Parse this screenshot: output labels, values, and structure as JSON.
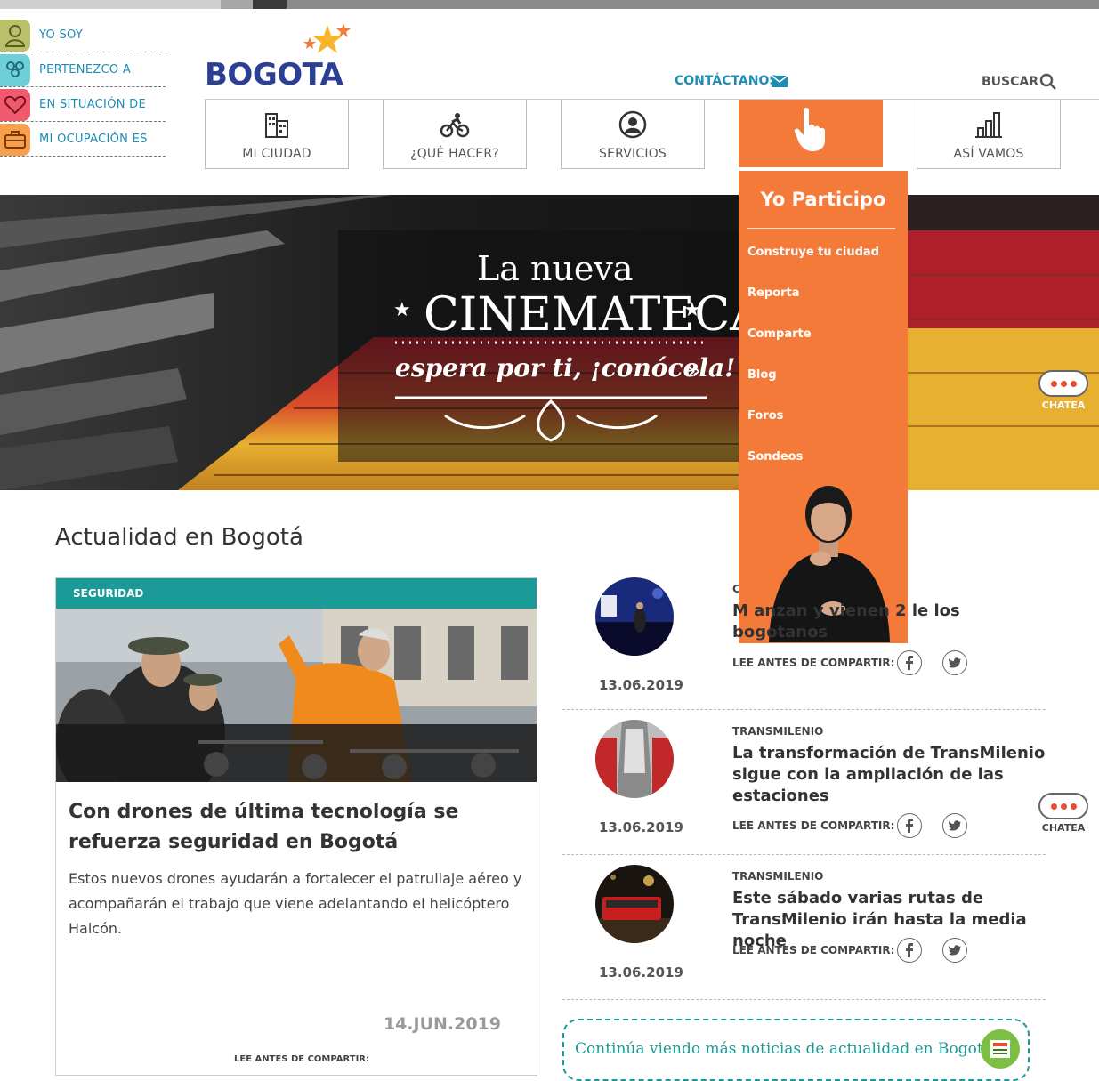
{
  "profiles": [
    {
      "label": "YO SOY",
      "color": "#b9c06a"
    },
    {
      "label": "PERTENEZCO A",
      "color": "#6fcfd8"
    },
    {
      "label": "EN SITUACIÓN DE",
      "color": "#f05a6e"
    },
    {
      "label": "MI OCUPACIÓN ES",
      "color": "#f6a04d"
    }
  ],
  "logo": {
    "word": "BOGOTA"
  },
  "header": {
    "contact": "CONTÁCTANOS",
    "search": "BUSCAR"
  },
  "nav": [
    {
      "label": "MI CIUDAD",
      "icon": "buildings-icon"
    },
    {
      "label": "¿QUÉ HACER?",
      "icon": "bicycle-icon"
    },
    {
      "label": "SERVICIOS",
      "icon": "person-circle-icon"
    },
    {
      "label": "",
      "icon": "hand-pointer-icon",
      "active": true
    },
    {
      "label": "ASÍ VAMOS",
      "icon": "bar-chart-icon"
    }
  ],
  "hero": {
    "line1": "La nueva",
    "line2": "CINEMATECA",
    "line3": "espera por ti, ¡conócela!"
  },
  "dropdown": {
    "title": "Yo Participo",
    "items": [
      "Construye tu ciudad",
      "Reporta",
      "Comparte",
      "Blog",
      "Foros",
      "Sondeos"
    ]
  },
  "chat": {
    "label": "CHATEA"
  },
  "section": {
    "title": "Actualidad en Bogotá"
  },
  "featured": {
    "category": "SEGURIDAD",
    "title": "Con drones de última tecnología se refuerza seguridad en Bogotá",
    "summary": "Estos nuevos drones ayudarán a fortalecer el patrullaje aéreo y acompañarán el trabajo que viene adelantando el helicóptero Halcón.",
    "date": "14.JUN.2019",
    "share": "LEE ANTES DE COMPARTIR:"
  },
  "news": [
    {
      "category": "C",
      "title": "M                         anzan y vienen 2                       le los bogotanos",
      "date": "13.06.2019",
      "share": "LEE ANTES DE COMPARTIR:"
    },
    {
      "category": "TRANSMILENIO",
      "title": "La transformación de TransMilenio sigue con la ampliación de las estaciones",
      "date": "13.06.2019",
      "share": "LEE ANTES DE COMPARTIR:"
    },
    {
      "category": "TRANSMILENIO",
      "title": "Este sábado varias rutas de TransMilenio irán hasta la media noche",
      "date": "13.06.2019",
      "share": "LEE ANTES DE COMPARTIR:"
    }
  ],
  "more": {
    "label": "Continúa viendo más noticias de actualidad en Bogotá"
  }
}
